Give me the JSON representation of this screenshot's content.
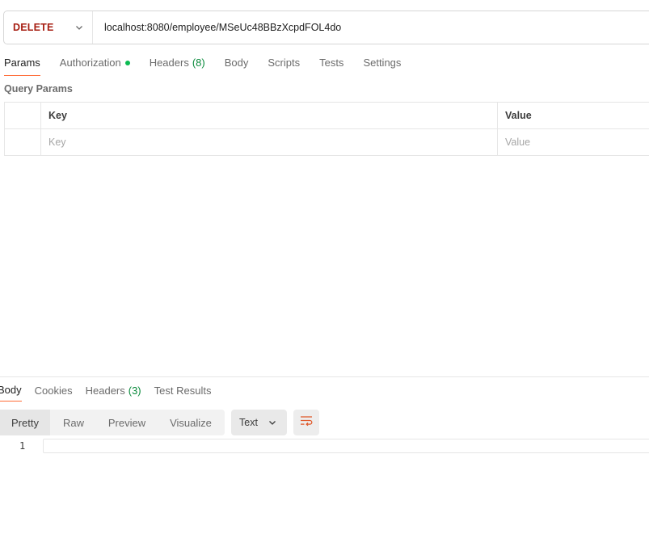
{
  "request": {
    "method": "DELETE",
    "method_color": "#a61e12",
    "url": "localhost:8080/employee/MSeUc48BBzXcpdFOL4do"
  },
  "request_tabs": [
    {
      "label": "Params",
      "active": true
    },
    {
      "label": "Authorization",
      "indicator_color": "#0cbb52"
    },
    {
      "label": "Headers",
      "count": "(8)"
    },
    {
      "label": "Body"
    },
    {
      "label": "Scripts"
    },
    {
      "label": "Tests"
    },
    {
      "label": "Settings"
    }
  ],
  "query_params": {
    "title": "Query Params",
    "headers": {
      "key": "Key",
      "value": "Value"
    },
    "placeholders": {
      "key": "Key",
      "value": "Value"
    }
  },
  "response_tabs": [
    {
      "label": "Body",
      "active": true
    },
    {
      "label": "Cookies"
    },
    {
      "label": "Headers",
      "count": "(3)"
    },
    {
      "label": "Test Results"
    }
  ],
  "view_modes": [
    "Pretty",
    "Raw",
    "Preview",
    "Visualize"
  ],
  "active_view_mode": "Pretty",
  "format": "Text",
  "editor": {
    "line_numbers": [
      "1"
    ]
  },
  "colors": {
    "accent": "#ff6c37",
    "count_green": "#0a8a3c"
  }
}
